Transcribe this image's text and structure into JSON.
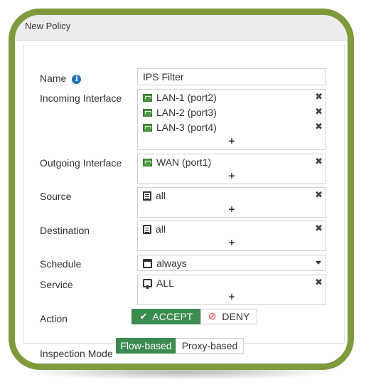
{
  "dialog": {
    "title": "New Policy"
  },
  "form": {
    "name": {
      "label": "Name",
      "value": "IPS Filter"
    },
    "incoming": {
      "label": "Incoming Interface",
      "items": [
        "LAN-1 (port2)",
        "LAN-2 (port3)",
        "LAN-3 (port4)"
      ]
    },
    "outgoing": {
      "label": "Outgoing Interface",
      "items": [
        "WAN (port1)"
      ]
    },
    "source": {
      "label": "Source",
      "items": [
        "all"
      ]
    },
    "destination": {
      "label": "Destination",
      "items": [
        "all"
      ]
    },
    "schedule": {
      "label": "Schedule",
      "value": "always"
    },
    "service": {
      "label": "Service",
      "items": [
        "ALL"
      ]
    },
    "action": {
      "label": "Action",
      "accept": "ACCEPT",
      "deny": "DENY",
      "selected": "ACCEPT"
    },
    "inspection": {
      "label": "Inspection Mode",
      "flow": "Flow-based",
      "proxy": "Proxy-based",
      "selected": "Flow-based"
    },
    "add_symbol": "+",
    "remove_symbol": "✖"
  },
  "icons": {
    "info": "info-icon",
    "port": "port-icon",
    "address": "address-icon",
    "schedule": "schedule-icon",
    "service": "service-icon",
    "remove": "close-icon",
    "add": "plus-icon",
    "dropdown": "chevron-down-icon",
    "accept": "check-icon",
    "deny": "deny-icon"
  },
  "colors": {
    "frame": "#7f9a3c",
    "accent_green": "#3b8b4f",
    "info_blue": "#1f72b8",
    "deny_red": "#d0312d"
  }
}
